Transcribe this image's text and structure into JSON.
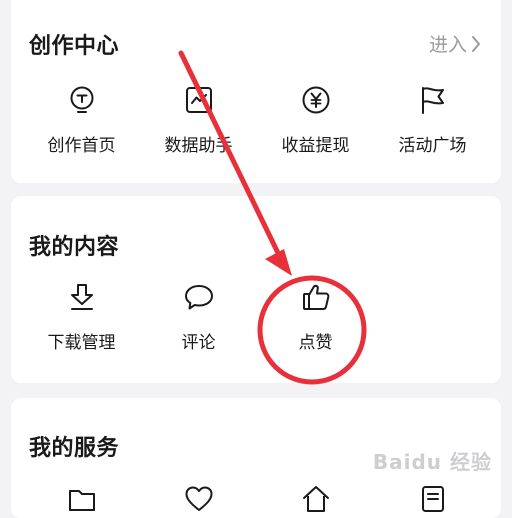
{
  "creation_center": {
    "title": "创作中心",
    "enter_label": "进入",
    "items": [
      {
        "label": "创作首页",
        "icon": "lightbulb-icon"
      },
      {
        "label": "数据助手",
        "icon": "chart-icon"
      },
      {
        "label": "收益提现",
        "icon": "yuan-coin-icon"
      },
      {
        "label": "活动广场",
        "icon": "flag-icon"
      }
    ]
  },
  "my_content": {
    "title": "我的内容",
    "items": [
      {
        "label": "下载管理",
        "icon": "download-icon"
      },
      {
        "label": "评论",
        "icon": "comment-icon"
      },
      {
        "label": "点赞",
        "icon": "thumbs-up-icon"
      }
    ]
  },
  "my_services": {
    "title": "我的服务",
    "items": [
      {
        "label": "",
        "icon": "folder-icon"
      },
      {
        "label": "",
        "icon": "heart-icon"
      },
      {
        "label": "",
        "icon": "home-icon"
      },
      {
        "label": "",
        "icon": "document-icon"
      }
    ]
  },
  "annotation_color": "#e8303a"
}
